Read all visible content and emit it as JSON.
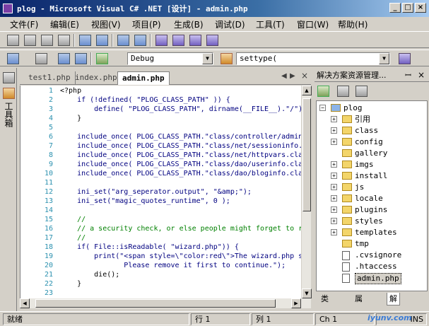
{
  "window": {
    "title": "plog - Microsoft Visual C# .NET [设计] - admin.php",
    "controls": {
      "minimize": "_",
      "maximize": "□",
      "close": "×"
    }
  },
  "menu": [
    "文件(F)",
    "编辑(E)",
    "视图(V)",
    "项目(P)",
    "生成(B)",
    "调试(D)",
    "工具(T)",
    "窗口(W)",
    "帮助(H)"
  ],
  "toolbar": {
    "configuration": "Debug",
    "search_combo": "settype("
  },
  "toolbox": {
    "label": "工具箱"
  },
  "tabs": [
    {
      "label": "test1.php",
      "active": false
    },
    {
      "label": "index.php",
      "active": false
    },
    {
      "label": "admin.php",
      "active": true
    }
  ],
  "tab_close": "×",
  "editor": {
    "lines": [
      {
        "n": "1",
        "t": "<?php"
      },
      {
        "n": "2",
        "t": "    if (!defined( \"PLOG_CLASS_PATH\" )) {"
      },
      {
        "n": "3",
        "t": "        define( \"PLOG_CLASS_PATH\", dirname(__FILE__).\"/\")"
      },
      {
        "n": "4",
        "t": "    }"
      },
      {
        "n": "5",
        "t": ""
      },
      {
        "n": "6",
        "t": "    include_once( PLOG_CLASS_PATH.\"class/controller/admin"
      },
      {
        "n": "7",
        "t": "    include_once( PLOG_CLASS_PATH.\"class/net/sessioninfo."
      },
      {
        "n": "8",
        "t": "    include_once( PLOG_CLASS_PATH.\"class/net/httpvars.cla"
      },
      {
        "n": "9",
        "t": "    include_once( PLOG_CLASS_PATH.\"class/dao/userinfo.cla"
      },
      {
        "n": "10",
        "t": "    include_once( PLOG_CLASS_PATH.\"class/dao/bloginfo.cla"
      },
      {
        "n": "11",
        "t": ""
      },
      {
        "n": "12",
        "t": "    ini_set(\"arg_seperator.output\", \"&amp;\");"
      },
      {
        "n": "13",
        "t": "    ini_set(\"magic_quotes_runtime\", 0 );"
      },
      {
        "n": "14",
        "t": ""
      },
      {
        "n": "15",
        "t": "    //"
      },
      {
        "n": "16",
        "t": "    // a security check, or else people might forget to r"
      },
      {
        "n": "17",
        "t": "    //"
      },
      {
        "n": "18",
        "t": "    if( File::isReadable( \"wizard.php\")) {"
      },
      {
        "n": "19",
        "t": "        print(\"<span style=\\\"color:red\\\">The wizard.php s"
      },
      {
        "n": "20",
        "t": "               Please remove it first to continue.\");"
      },
      {
        "n": "21",
        "t": "        die();"
      },
      {
        "n": "22",
        "t": "    }"
      },
      {
        "n": "23",
        "t": ""
      }
    ]
  },
  "solution": {
    "title": "解决方案资源管理...",
    "pin": "ꟷ",
    "close": "×",
    "tree": [
      {
        "label": "plog",
        "type": "project",
        "level": 0,
        "expander": "−"
      },
      {
        "label": "引用",
        "type": "folder",
        "level": 1,
        "expander": "+"
      },
      {
        "label": "class",
        "type": "folder",
        "level": 1,
        "expander": "+"
      },
      {
        "label": "config",
        "type": "folder",
        "level": 1,
        "expander": "+"
      },
      {
        "label": "gallery",
        "type": "folder",
        "level": 1,
        "expander": ""
      },
      {
        "label": "imgs",
        "type": "folder",
        "level": 1,
        "expander": "+"
      },
      {
        "label": "install",
        "type": "folder",
        "level": 1,
        "expander": "+"
      },
      {
        "label": "js",
        "type": "folder",
        "level": 1,
        "expander": "+"
      },
      {
        "label": "locale",
        "type": "folder",
        "level": 1,
        "expander": "+"
      },
      {
        "label": "plugins",
        "type": "folder",
        "level": 1,
        "expander": "+"
      },
      {
        "label": "styles",
        "type": "folder",
        "level": 1,
        "expander": "+"
      },
      {
        "label": "templates",
        "type": "folder",
        "level": 1,
        "expander": "+"
      },
      {
        "label": "tmp",
        "type": "folder",
        "level": 1,
        "expander": ""
      },
      {
        "label": ".cvsignore",
        "type": "file",
        "level": 1,
        "expander": ""
      },
      {
        "label": ".htaccess",
        "type": "file",
        "level": 1,
        "expander": ""
      },
      {
        "label": "admin.php",
        "type": "file",
        "level": 1,
        "expander": "",
        "selected": true
      }
    ],
    "bottom_tabs": [
      "类",
      "属",
      "解"
    ]
  },
  "status": {
    "ready": "就绪",
    "row": "行 1",
    "col": "列 1",
    "ch": "Ch 1",
    "ins": "INS"
  },
  "watermark": "iyunv.com"
}
